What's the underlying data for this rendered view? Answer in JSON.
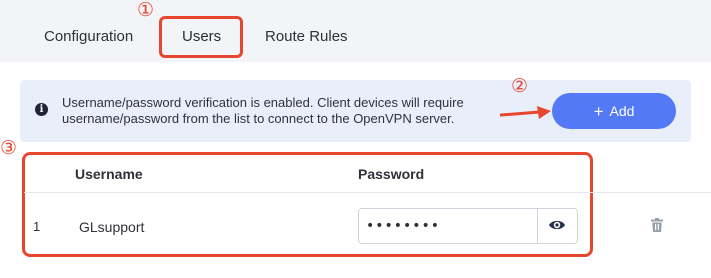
{
  "tabs": [
    {
      "label": "Configuration"
    },
    {
      "label": "Users"
    },
    {
      "label": "Route Rules"
    }
  ],
  "active_tab": "Users",
  "annotations": {
    "step1": "①",
    "step2": "②",
    "step3": "③"
  },
  "info": {
    "icon": "info-icon",
    "line1": "Username/password verification is enabled. Client devices will require",
    "line2": "username/password from the list to connect to the OpenVPN server."
  },
  "add_button": {
    "icon": "plus",
    "plus_glyph": "+",
    "label": "Add"
  },
  "table": {
    "columns": [
      "Username",
      "Password"
    ],
    "rows": [
      {
        "index": "1",
        "username": "GLsupport",
        "password_masked": "••••••••"
      }
    ]
  },
  "colors": {
    "accent": "#5479f7",
    "annotation": "#e8462f",
    "info_bg": "#e9eefb"
  }
}
